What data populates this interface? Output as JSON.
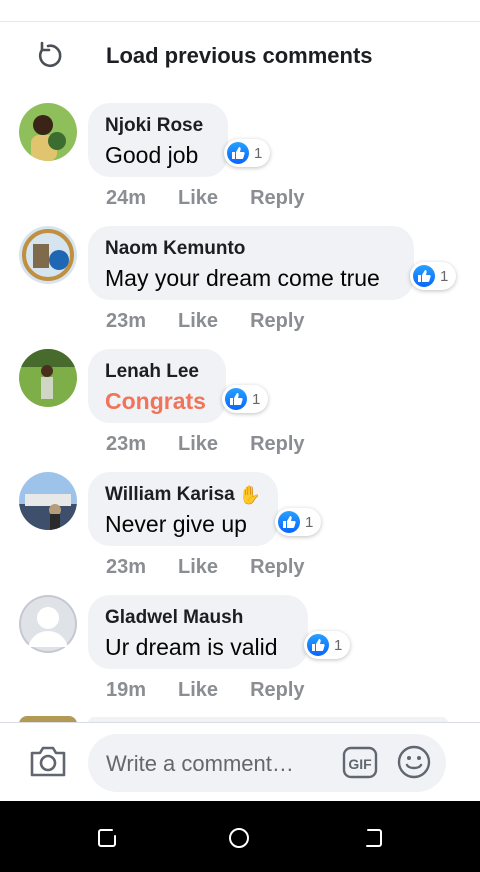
{
  "header": {
    "load_previous_label": "Load previous comments"
  },
  "comments": [
    {
      "name": "Njoki Rose",
      "text": "Good job",
      "reaction_count": "1",
      "time": "24m",
      "like_label": "Like",
      "reply_label": "Reply",
      "highlight": false,
      "avatar_colors": [
        "#8fbf5a",
        "#3a6d2f",
        "#e1c56e"
      ]
    },
    {
      "name": "Naom Kemunto",
      "text": "May your dream come true",
      "reaction_count": "1",
      "time": "23m",
      "like_label": "Like",
      "reply_label": "Reply",
      "highlight": false,
      "avatar_colors": [
        "#d5e4ef",
        "#1f67b3",
        "#c08f3f"
      ]
    },
    {
      "name": "Lenah Lee",
      "text": "Congrats",
      "reaction_count": "1",
      "time": "23m",
      "like_label": "Like",
      "reply_label": "Reply",
      "highlight": true,
      "avatar_colors": [
        "#7eae47",
        "#466b2c",
        "#cfd6c5"
      ]
    },
    {
      "name": "William Karisa",
      "text": "Never give up",
      "reaction_count": "1",
      "time": "23m",
      "like_label": "Like",
      "reply_label": "Reply",
      "highlight": false,
      "avatar_colors": [
        "#9ec3ea",
        "#3d4f6a",
        "#b69c79"
      ]
    },
    {
      "name": "Gladwel Maush",
      "text": "Ur dream is valid",
      "reaction_count": "1",
      "time": "19m",
      "like_label": "Like",
      "reply_label": "Reply",
      "highlight": false,
      "avatar_colors": [
        "#dfe3e8",
        "#c4c9cf",
        "#ffffff"
      ]
    }
  ],
  "composer": {
    "placeholder": "Write a comment…",
    "gif_label": "GIF"
  },
  "icons": {
    "load_previous": "refresh-icon",
    "reaction": "thumbs-up-icon",
    "camera": "camera-icon",
    "gif": "gif-icon",
    "emoji": "emoji-icon",
    "nav_recent": "recent-apps-icon",
    "nav_home": "home-icon",
    "nav_back": "back-icon"
  },
  "colors": {
    "like_blue": "#1877f2",
    "highlight_text": "#f0735a",
    "bubble_bg": "#f0f2f5",
    "meta_gray": "#8a8d91"
  }
}
